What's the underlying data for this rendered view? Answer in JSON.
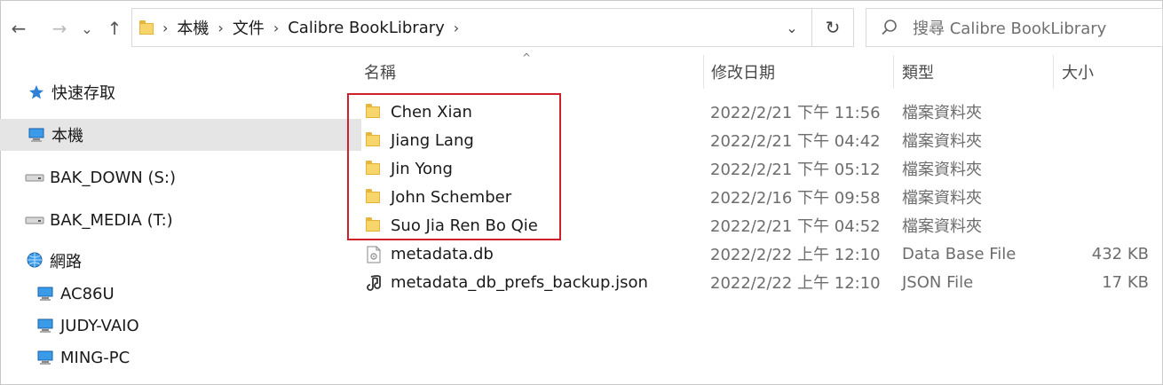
{
  "nav": {
    "back": "←",
    "forward": "→",
    "recent": "⌄",
    "up": "↑"
  },
  "address": {
    "crumbs": [
      "本機",
      "文件",
      "Calibre BookLibrary"
    ],
    "separator": "›",
    "dropdown": "⌄",
    "refresh": "↻"
  },
  "search": {
    "placeholder": "搜尋 Calibre BookLibrary"
  },
  "sidebar": {
    "items": [
      {
        "label": "快速存取",
        "icon": "star-icon"
      },
      {
        "label": "本機",
        "icon": "computer-icon",
        "selected": true
      },
      {
        "label": "BAK_DOWN (S:)",
        "icon": "drive-icon"
      },
      {
        "label": "BAK_MEDIA (T:)",
        "icon": "drive-icon"
      },
      {
        "label": "網路",
        "icon": "network-icon"
      },
      {
        "label": "AC86U",
        "icon": "computer-icon"
      },
      {
        "label": "JUDY-VAIO",
        "icon": "computer-icon"
      },
      {
        "label": "MING-PC",
        "icon": "computer-icon"
      }
    ]
  },
  "columns": {
    "name": "名稱",
    "date": "修改日期",
    "type": "類型",
    "size": "大小",
    "sort_indicator": "^"
  },
  "files": [
    {
      "name": "Chen Xian",
      "date": "2022/2/21 下午 11:56",
      "type": "檔案資料夾",
      "size": "",
      "icon": "folder-icon"
    },
    {
      "name": "Jiang Lang",
      "date": "2022/2/21 下午 04:42",
      "type": "檔案資料夾",
      "size": "",
      "icon": "folder-icon"
    },
    {
      "name": "Jin Yong",
      "date": "2022/2/21 下午 05:12",
      "type": "檔案資料夾",
      "size": "",
      "icon": "folder-icon"
    },
    {
      "name": "John Schember",
      "date": "2022/2/16 下午 09:58",
      "type": "檔案資料夾",
      "size": "",
      "icon": "folder-icon"
    },
    {
      "name": "Suo Jia Ren Bo Qie",
      "date": "2022/2/21 下午 04:52",
      "type": "檔案資料夾",
      "size": "",
      "icon": "folder-icon"
    },
    {
      "name": "metadata.db",
      "date": "2022/2/22 上午 12:10",
      "type": "Data Base File",
      "size": "432 KB",
      "icon": "database-file-icon"
    },
    {
      "name": "metadata_db_prefs_backup.json",
      "date": "2022/2/22 上午 12:10",
      "type": "JSON File",
      "size": "17 KB",
      "icon": "json-file-icon"
    }
  ],
  "colors": {
    "highlight_border": "#d0212a",
    "selected_bg": "#e5e5e5",
    "folder": "#f8d56b"
  }
}
